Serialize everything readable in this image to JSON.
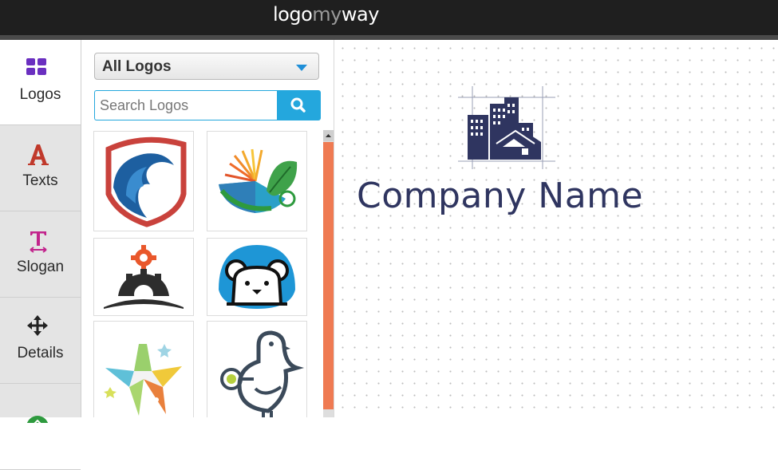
{
  "header": {
    "brand_part1": "logo",
    "brand_part2": "my",
    "brand_part3": "way"
  },
  "rail": {
    "items": [
      {
        "label": "Logos",
        "icon": "grid-icon",
        "active": true
      },
      {
        "label": "Texts",
        "icon": "letter-a-icon",
        "active": false
      },
      {
        "label": "Slogan",
        "icon": "text-cursor-icon",
        "active": false
      },
      {
        "label": "Details",
        "icon": "move-arrows-icon",
        "active": false
      }
    ]
  },
  "panel": {
    "category_selected": "All Logos",
    "search_placeholder": "Search Logos",
    "thumbnails": [
      {
        "icon": "shield-wave-logo"
      },
      {
        "icon": "sun-leaf-logo"
      },
      {
        "icon": "gear-sunrise-logo"
      },
      {
        "icon": "bear-face-logo"
      },
      {
        "icon": "colorful-star-logo"
      },
      {
        "icon": "bird-logo"
      }
    ]
  },
  "canvas": {
    "logo_icon": "city-buildings-logo",
    "company_name": "Company Name"
  },
  "colors": {
    "accent_blue": "#24a7dd",
    "scroll_orange": "#ef7a52",
    "text_navy": "#2f3560",
    "rail_icon_purple": "#6a2fc0",
    "rail_icon_red": "#c0392b",
    "rail_icon_pink": "#c2248c"
  }
}
